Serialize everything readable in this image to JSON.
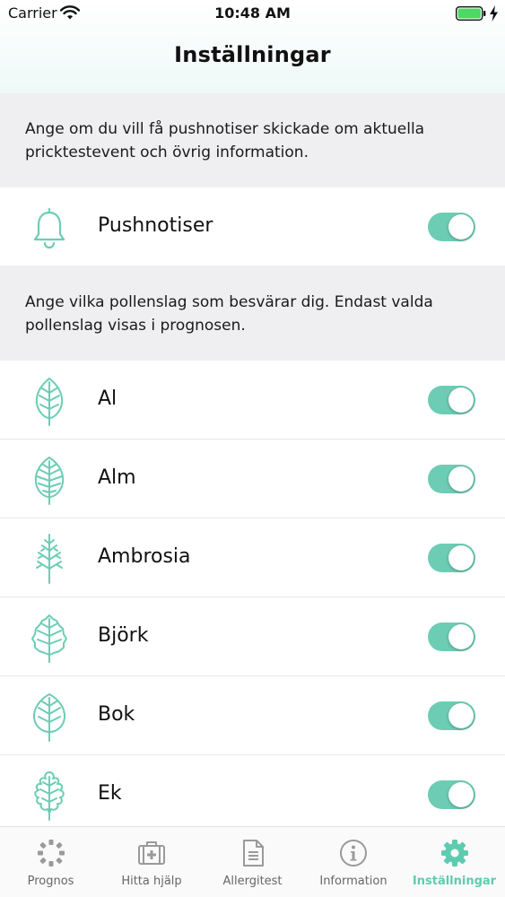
{
  "status_bar": {
    "carrier": "Carrier",
    "time": "10:48 AM"
  },
  "nav": {
    "title": "Inställningar"
  },
  "push_section": {
    "description": "Ange om du vill få pushnotiser skickade om aktuella pricktestevent och övrig information.",
    "item": {
      "label": "Pushnotiser",
      "icon": "bell-icon",
      "enabled": true
    }
  },
  "pollen_section": {
    "description": "Ange vilka pollenslag som besvärar dig. Endast valda pollenslag visas i prognosen.",
    "items": [
      {
        "label": "Al",
        "icon": "alder-leaf-icon",
        "enabled": true
      },
      {
        "label": "Alm",
        "icon": "elm-leaf-icon",
        "enabled": true
      },
      {
        "label": "Ambrosia",
        "icon": "ragweed-icon",
        "enabled": true
      },
      {
        "label": "Björk",
        "icon": "birch-leaf-icon",
        "enabled": true
      },
      {
        "label": "Bok",
        "icon": "beech-leaf-icon",
        "enabled": true
      },
      {
        "label": "Ek",
        "icon": "oak-leaf-icon",
        "enabled": true
      }
    ]
  },
  "tabs": [
    {
      "label": "Prognos",
      "icon": "forecast-icon",
      "active": false
    },
    {
      "label": "Hitta hjälp",
      "icon": "first-aid-kit-icon",
      "active": false
    },
    {
      "label": "Allergitest",
      "icon": "document-icon",
      "active": false
    },
    {
      "label": "Information",
      "icon": "info-icon",
      "active": false
    },
    {
      "label": "Inställningar",
      "icon": "gear-icon",
      "active": true
    }
  ],
  "colors": {
    "accent": "#6ccdb4",
    "tab_active": "#5ecbb0",
    "tab_inactive": "#999999",
    "section_bg": "#efeff1"
  }
}
